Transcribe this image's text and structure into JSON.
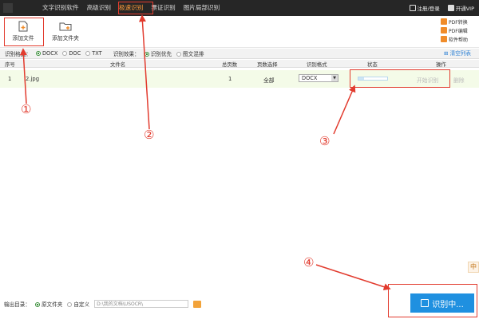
{
  "nav": {
    "tabs": [
      "文字识别软件",
      "高级识别",
      "极速识别",
      "票证识别",
      "图片局部识别"
    ],
    "active_index": 2
  },
  "topright": {
    "login": "注册/登录",
    "vip": "开通VIP"
  },
  "toolbar": {
    "add_file": "添加文件",
    "add_folder": "添加文件夹"
  },
  "side_buttons": [
    "PDF转换",
    "PDF编辑",
    "软件帮助"
  ],
  "options": {
    "format_label": "识别格式：",
    "formats": [
      "DOCX",
      "DOC",
      "TXT"
    ],
    "format_selected": "DOCX",
    "effect_label": "识别效果：",
    "effects": [
      "识别优先",
      "图文混排"
    ],
    "effect_selected": "识别优先",
    "clear_list": "清空列表"
  },
  "table": {
    "headers": [
      "序号",
      "文件名",
      "总页数",
      "页数选择",
      "识别格式",
      "状态",
      "操作"
    ],
    "rows": [
      {
        "index": "1",
        "filename": "2.jpg",
        "pages": "1",
        "page_select": "全部",
        "format": "DOCX",
        "progress": 0.2,
        "start": "开始识别",
        "delete": "删除"
      }
    ]
  },
  "output": {
    "label": "输出目录：",
    "opt_original": "原文件夹",
    "opt_custom": "自定义",
    "path": "D:\\我的文档\\USOCR\\"
  },
  "run_button": "识别中...",
  "ime": "中",
  "markers": [
    "①",
    "②",
    "③",
    "④"
  ],
  "colors": {
    "accent": "#1f90e0",
    "annotation": "#e23b2e",
    "active_tab": "#ff9b3a"
  }
}
